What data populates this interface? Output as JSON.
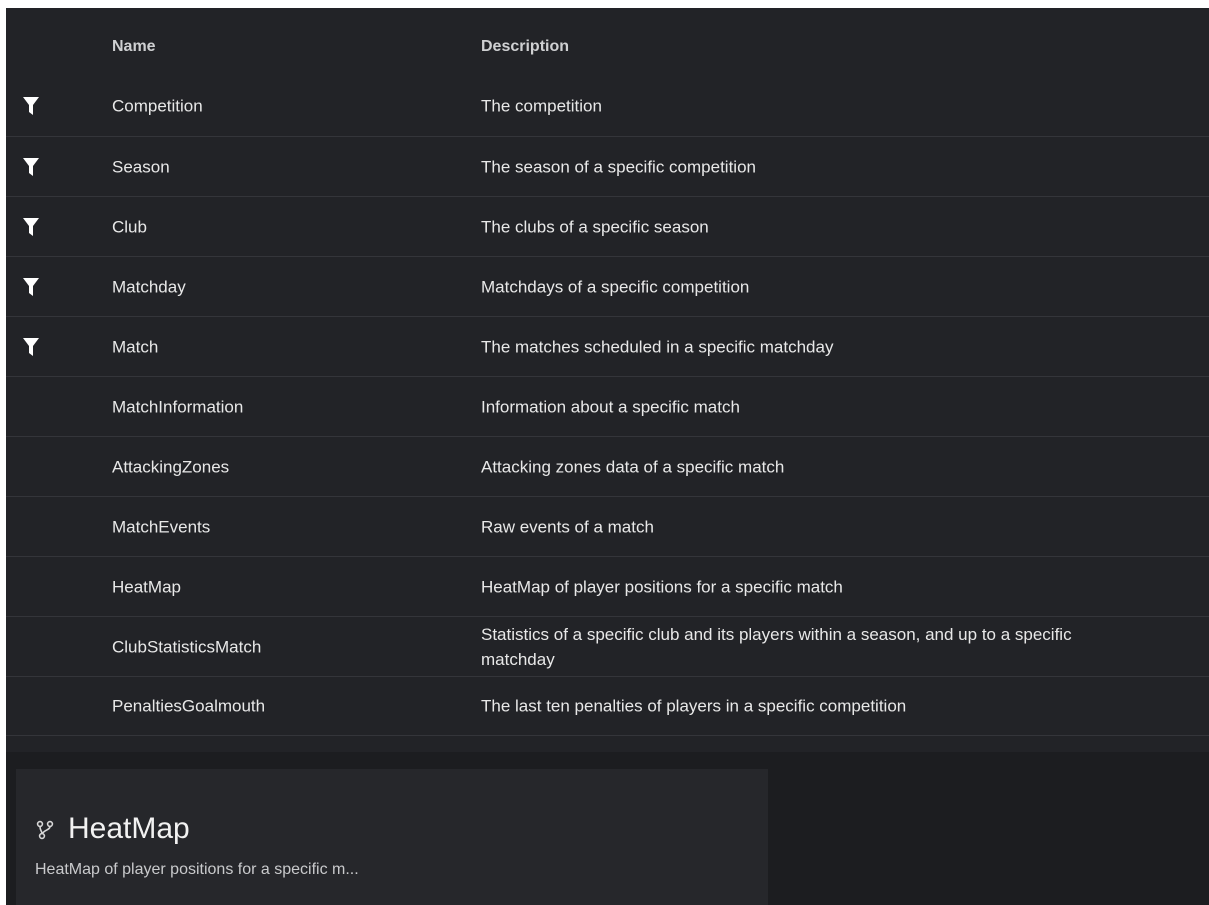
{
  "table": {
    "headers": {
      "name": "Name",
      "description": "Description"
    },
    "rows": [
      {
        "name": "Competition",
        "description": "The competition",
        "filter": true
      },
      {
        "name": "Season",
        "description": "The season of a specific competition",
        "filter": true
      },
      {
        "name": "Club",
        "description": "The clubs of a specific season",
        "filter": true
      },
      {
        "name": "Matchday",
        "description": "Matchdays of a specific competition",
        "filter": true
      },
      {
        "name": "Match",
        "description": "The matches scheduled in a specific matchday",
        "filter": true
      },
      {
        "name": "MatchInformation",
        "description": "Information about a specific match",
        "filter": false
      },
      {
        "name": "AttackingZones",
        "description": "Attacking zones data of a specific match",
        "filter": false
      },
      {
        "name": "MatchEvents",
        "description": "Raw events of a match",
        "filter": false
      },
      {
        "name": "HeatMap",
        "description": "HeatMap of player positions for a specific match",
        "filter": false
      },
      {
        "name": "ClubStatisticsMatch",
        "description": "Statistics of a specific club and its players within a season, and up to a specific matchday",
        "filter": false
      },
      {
        "name": "PenaltiesGoalmouth",
        "description": "The last ten penalties of players in a specific competition",
        "filter": false
      }
    ]
  },
  "card": {
    "icon": "branch-icon",
    "title": "HeatMap",
    "description": "HeatMap of player positions for a specific m..."
  },
  "colors": {
    "background": "#1c1d20",
    "table_background": "#222327",
    "text": "#e8e8e8",
    "divider": "#34353a"
  }
}
